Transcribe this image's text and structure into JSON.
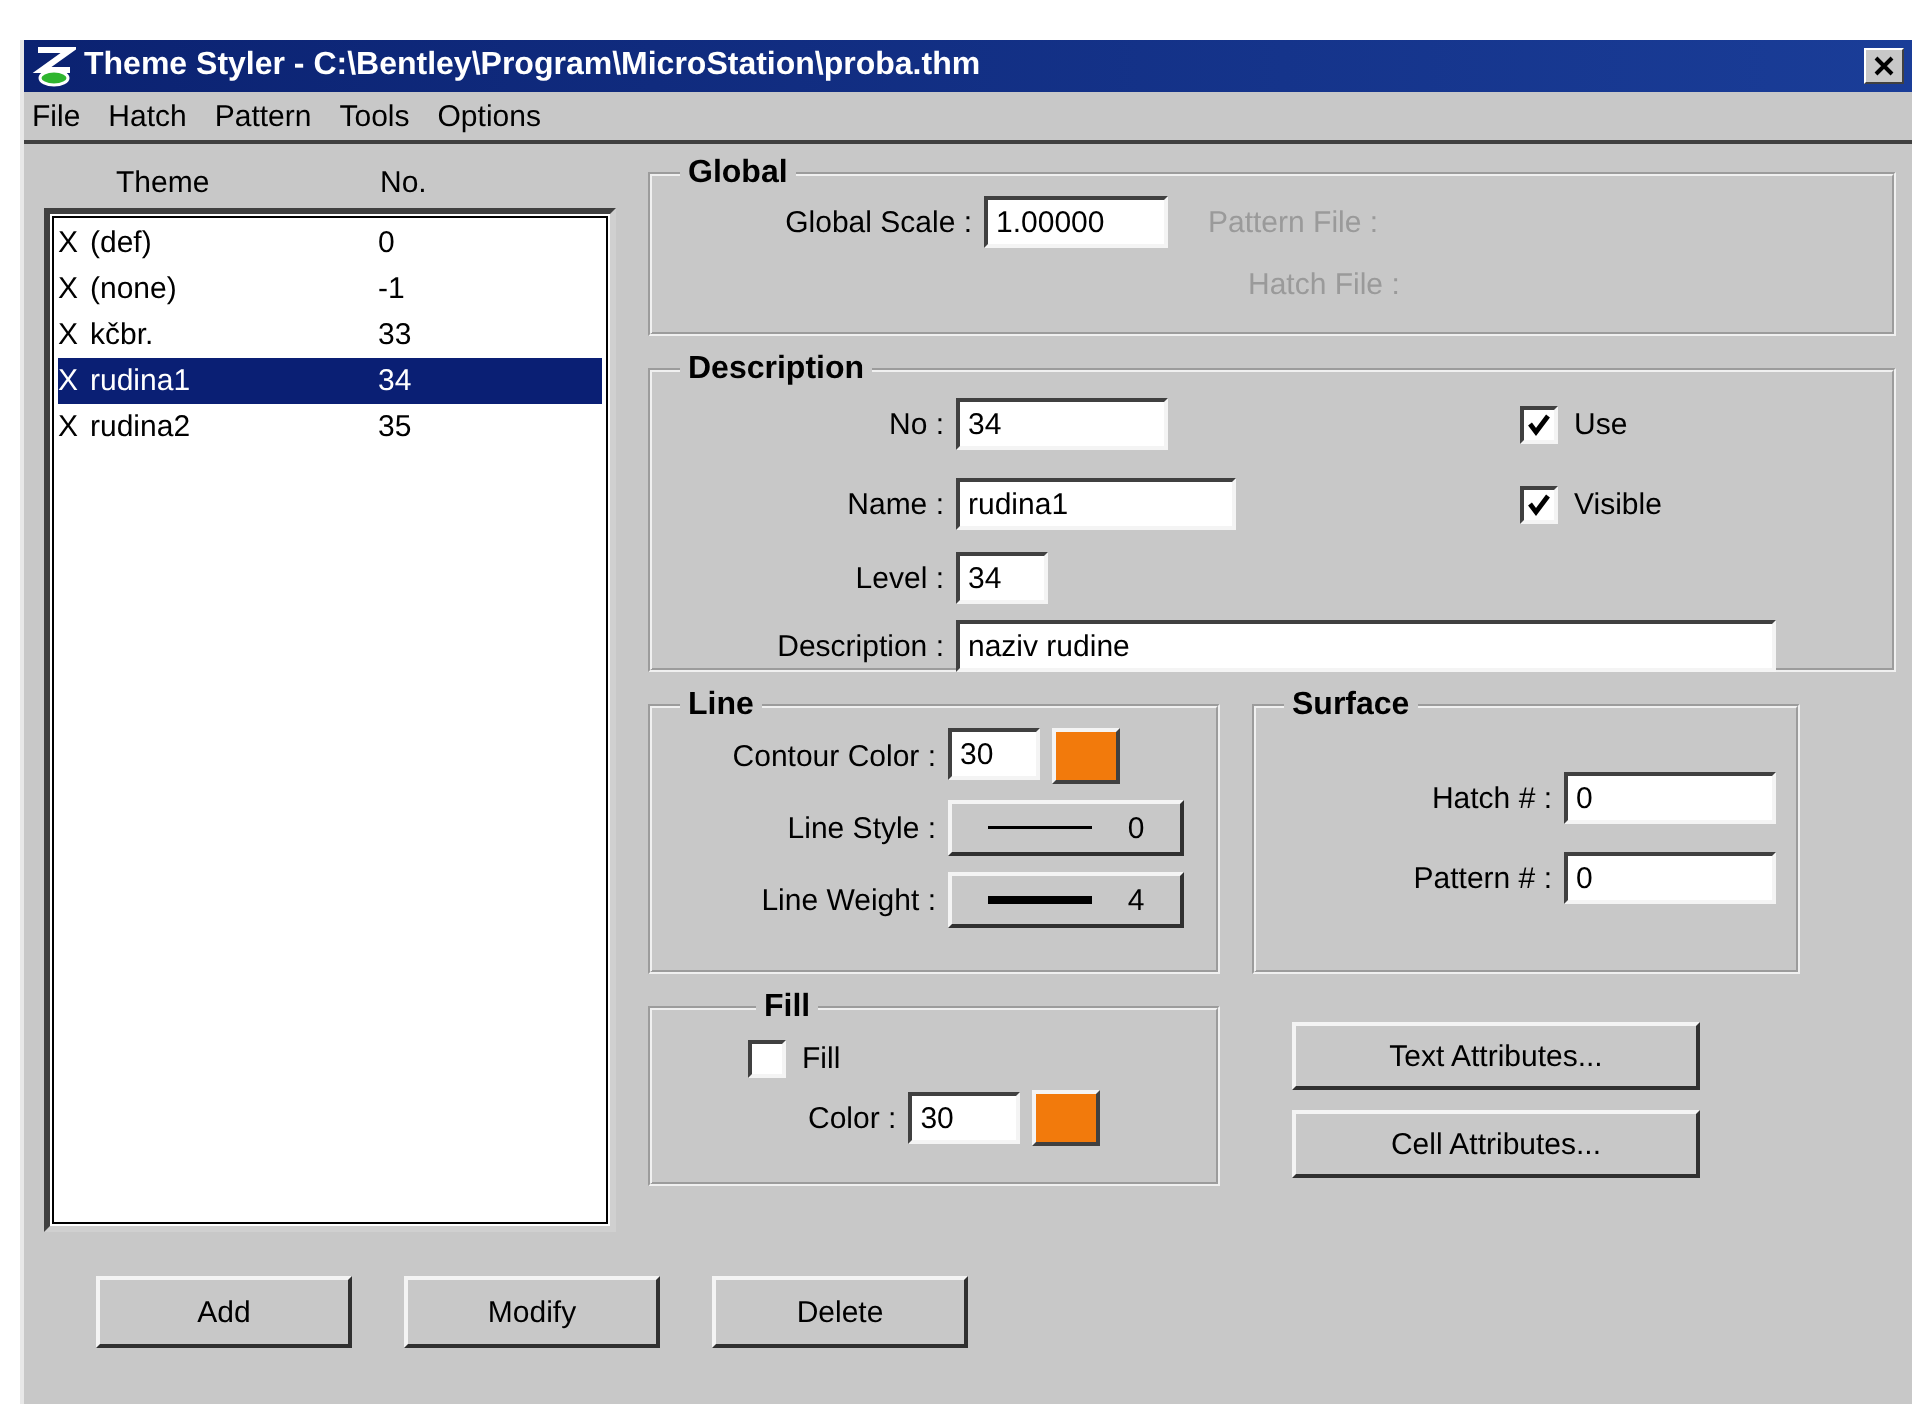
{
  "window": {
    "title": "Theme Styler - C:\\Bentley\\Program\\MicroStation\\proba.thm"
  },
  "menu": [
    {
      "label": "File"
    },
    {
      "label": "Hatch"
    },
    {
      "label": "Pattern"
    },
    {
      "label": "Tools"
    },
    {
      "label": "Options"
    }
  ],
  "theme_list": {
    "columns": [
      "Theme",
      "No."
    ],
    "rows": [
      {
        "mark": "X",
        "theme": "(def)",
        "no": "0",
        "selected": false
      },
      {
        "mark": "X",
        "theme": "(none)",
        "no": "-1",
        "selected": false
      },
      {
        "mark": "X",
        "theme": "kčbr.",
        "no": "33",
        "selected": false
      },
      {
        "mark": "X",
        "theme": "rudina1",
        "no": "34",
        "selected": true
      },
      {
        "mark": "X",
        "theme": "rudina2",
        "no": "35",
        "selected": false
      }
    ]
  },
  "global": {
    "title": "Global",
    "scale": {
      "label": "Global Scale :",
      "value": "1.00000"
    },
    "pattern_file": {
      "label": "Pattern File :",
      "disabled": true
    },
    "hatch_file": {
      "label": "Hatch File :",
      "disabled": true
    }
  },
  "description": {
    "title": "Description",
    "fields": [
      {
        "label": "No :",
        "value": "34"
      },
      {
        "label": "Name :",
        "value": "rudina1"
      },
      {
        "label": "Level :",
        "value": "34"
      },
      {
        "label": "Description :",
        "value": "naziv rudine"
      }
    ],
    "checks": [
      {
        "label": "Use",
        "checked": true
      },
      {
        "label": "Visible",
        "checked": true
      }
    ]
  },
  "line": {
    "title": "Line",
    "contour": {
      "label": "Contour Color :",
      "value": "30",
      "color": "#f27a0c"
    },
    "pickers": [
      {
        "kind": "style",
        "label": "Line Style :",
        "value": "0"
      },
      {
        "kind": "weight",
        "label": "Line Weight :",
        "value": "4"
      }
    ]
  },
  "surface": {
    "title": "Surface",
    "fields": [
      {
        "label": "Hatch # :",
        "value": "0"
      },
      {
        "label": "Pattern # :",
        "value": "0"
      }
    ]
  },
  "fill": {
    "title": "Fill",
    "check": {
      "label": "Fill",
      "checked": false
    },
    "color": {
      "label": "Color :",
      "value": "30",
      "color": "#f27a0c"
    }
  },
  "attribute_buttons": [
    {
      "label": "Text Attributes..."
    },
    {
      "label": "Cell Attributes..."
    }
  ],
  "bottom_buttons": [
    {
      "label": "Add"
    },
    {
      "label": "Modify"
    },
    {
      "label": "Delete"
    }
  ]
}
